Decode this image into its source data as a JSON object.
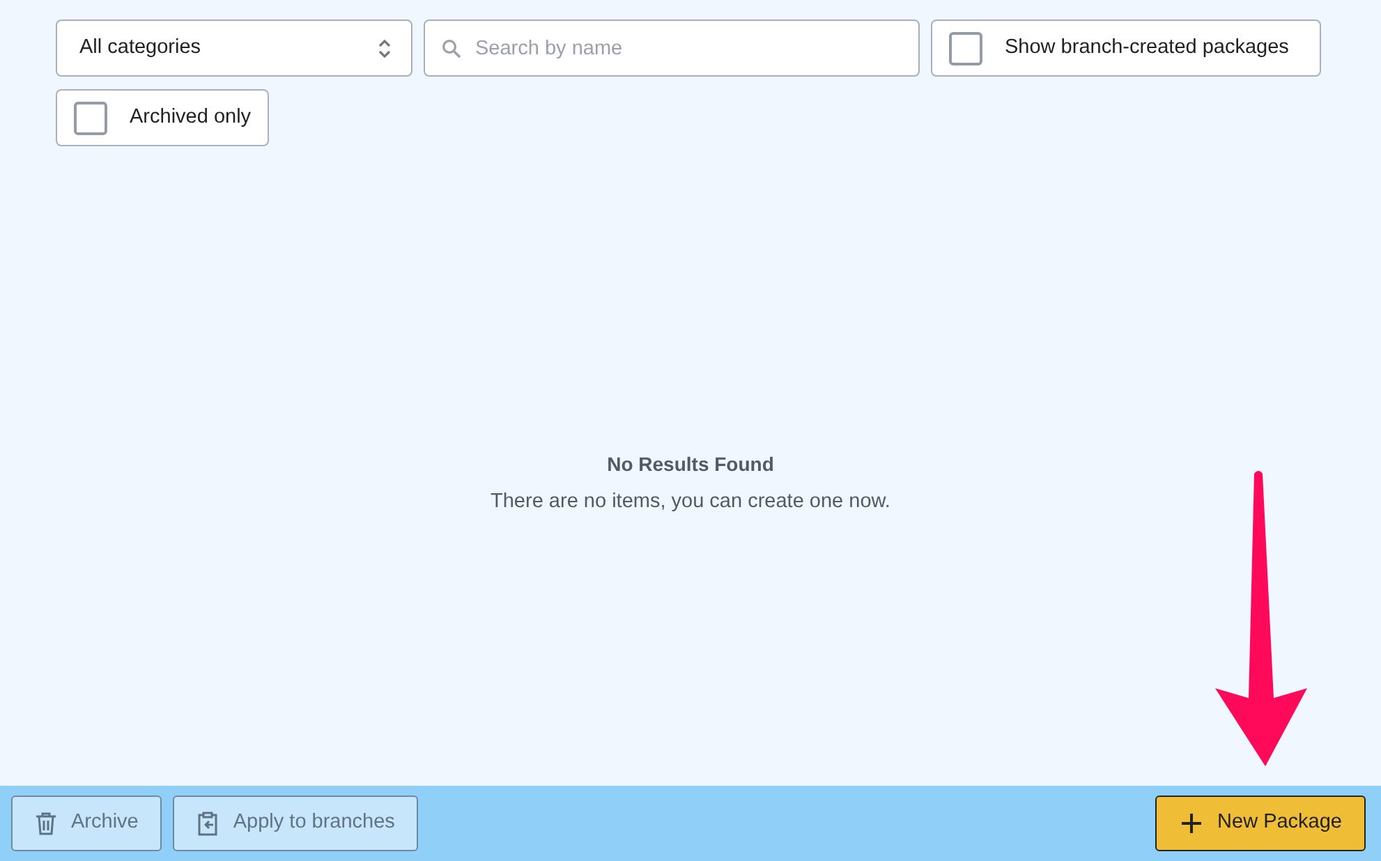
{
  "filters": {
    "category_select": {
      "value": "All categories"
    },
    "search": {
      "placeholder": "Search by name"
    },
    "checkboxes": [
      {
        "label": "Show branch-created packages",
        "checked": false
      },
      {
        "label": "Archived only",
        "checked": false
      }
    ]
  },
  "empty_state": {
    "title": "No Results Found",
    "message": "There are no items, you can create one now."
  },
  "footer": {
    "left_buttons": [
      {
        "label": "Archive",
        "kind": "archive",
        "disabled": true
      },
      {
        "label": "Apply to branches",
        "kind": "apply",
        "disabled": true
      }
    ],
    "primary_button": {
      "label": "New Package",
      "disabled": false
    }
  },
  "annotation": {
    "kind": "arrow"
  }
}
